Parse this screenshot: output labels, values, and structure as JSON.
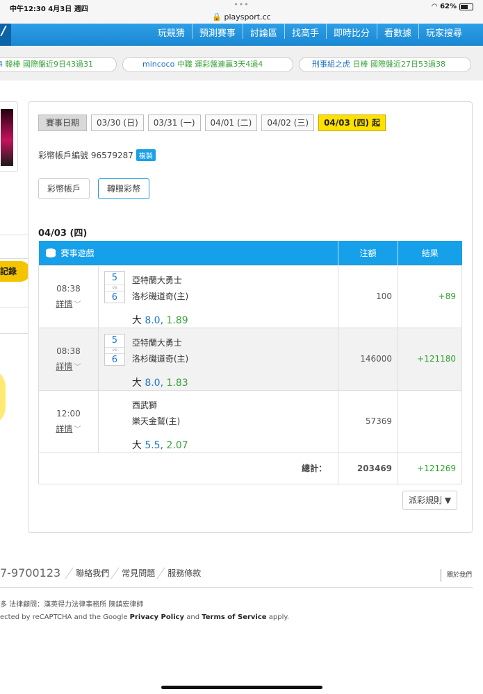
{
  "status_bar": {
    "time_date": "中午12:30   4月3日 週四",
    "dots": "•••",
    "url": "playsport.cc",
    "battery": "62%",
    "battery_level": 0.62
  },
  "nav": {
    "logo_fragment": "/",
    "items": [
      "玩競猜",
      "預測賽事",
      "討論區",
      "找高手",
      "即時比分",
      "看數據",
      "玩家搜尋"
    ]
  },
  "ticker": [
    {
      "name": "4",
      "info": "韓棒  國際盤近9日43過31"
    },
    {
      "name": "mincoco",
      "info": "中職  運彩盤連贏3天4過4"
    },
    {
      "name": "刑事組之虎",
      "info": "日棒  國際盤近27日53過38"
    }
  ],
  "sidebar": {
    "tab_label": "記錄"
  },
  "panel": {
    "date_label": "賽事日期",
    "dates": [
      "03/30 (日)",
      "03/31 (一)",
      "04/01 (二)",
      "04/02 (三)",
      "04/03 (四) 起"
    ],
    "account_label": "彩幣帳戶編號 96579287",
    "copy_label": "複製",
    "tabs": [
      "彩幣帳戶",
      "轉贈彩幣"
    ],
    "day_title": "04/03 (四)",
    "table": {
      "headers": [
        "賽事遊戲",
        "注額",
        "結果"
      ],
      "detail_label": "詳情",
      "rows": [
        {
          "time": "08:38",
          "score_away": "5",
          "vs": "vs",
          "score_home": "6",
          "away": "亞特蘭大勇士",
          "home": "洛杉磯道奇(主)",
          "bet_type": "大",
          "line": "8.0",
          "odds": "1.89",
          "amount": "100",
          "result": "+89"
        },
        {
          "time": "08:38",
          "score_away": "5",
          "vs": "vs",
          "score_home": "6",
          "away": "亞特蘭大勇士",
          "home": "洛杉磯道奇(主)",
          "bet_type": "大",
          "line": "8.0",
          "odds": "1.83",
          "amount": "146000",
          "result": "+121180"
        },
        {
          "time": "12:00",
          "score_away": "",
          "vs": "",
          "score_home": "",
          "away": "西武獅",
          "home": "樂天金鷲(主)",
          "bet_type": "大",
          "line": "5.5",
          "odds": "2.07",
          "amount": "57369",
          "result": ""
        }
      ],
      "total_label": "總計：",
      "total_amount": "203469",
      "total_result": "+121269"
    },
    "rule_button": "派彩規則 ▼"
  },
  "footer": {
    "phone": "7-9700123",
    "links": [
      "聯絡我們",
      "常見問題",
      "服務條款"
    ],
    "about": "關於我們",
    "legal": "多 法律顧問：漢英得力法律事務所 陳鎮宏律師",
    "recaptcha_pre": "ected by reCAPTCHA and the Google ",
    "privacy": "Privacy Policy",
    "and": " and ",
    "terms": "Terms of Service",
    "apply": " apply."
  }
}
